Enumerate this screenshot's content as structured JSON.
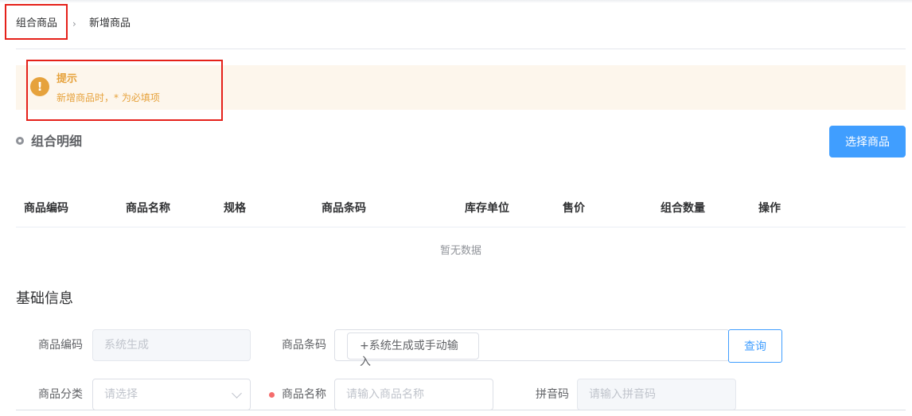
{
  "breadcrumb": {
    "parent": "组合商品",
    "separator": "›",
    "current": "新增商品"
  },
  "alert": {
    "icon": "!",
    "title": "提示",
    "description": "新增商品时，* 为必填项",
    "color": "#e6a23c"
  },
  "combo_detail": {
    "title": "组合明细",
    "select_button": "选择商品",
    "columns": [
      "商品编码",
      "商品名称",
      "规格",
      "商品条码",
      "库存单位",
      "售价",
      "组合数量",
      "操作"
    ],
    "rows": [],
    "empty_text": "暂无数据"
  },
  "basic_info": {
    "title": "基础信息",
    "product_code": {
      "label": "商品编码",
      "placeholder": "系统生成"
    },
    "barcode": {
      "label": "商品条码",
      "inner_button": "+系统生成或手动输入",
      "query_button": "查询"
    },
    "category": {
      "label": "商品分类",
      "placeholder": "请选择"
    },
    "product_name": {
      "label": "商品名称",
      "placeholder": "请输入商品名称",
      "required": true
    },
    "pinyin": {
      "label": "拼音码",
      "placeholder": "请输入拼音码"
    }
  },
  "colors": {
    "primary": "#409eff",
    "warning": "#e6a23c",
    "required": "#f56c6c",
    "highlight_box": "#e5211a"
  }
}
